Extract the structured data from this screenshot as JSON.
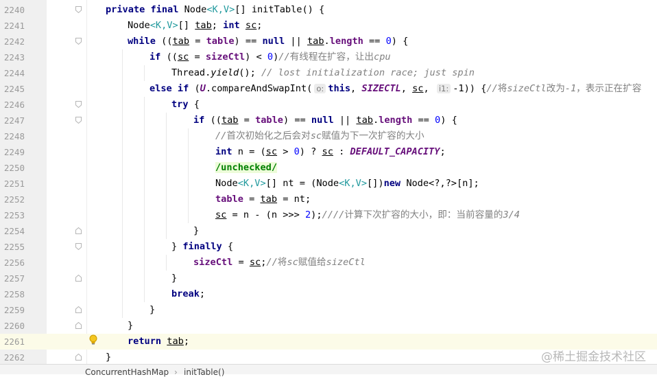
{
  "editor": {
    "lines": [
      {
        "num": "2240",
        "indent": 0,
        "fold": "open",
        "tokens": [
          [
            "kw",
            "private "
          ],
          [
            "kw",
            "final "
          ],
          [
            "",
            "Node"
          ],
          [
            "gen",
            "<K,V>"
          ],
          [
            "",
            "[] initTable() {"
          ]
        ]
      },
      {
        "num": "2241",
        "indent": 1,
        "tokens": [
          [
            "",
            "Node"
          ],
          [
            "gen",
            "<K,V>"
          ],
          [
            "",
            "[] "
          ],
          [
            "ul",
            "tab"
          ],
          [
            "",
            "; "
          ],
          [
            "kw",
            "int "
          ],
          [
            "ul",
            "sc"
          ],
          [
            "",
            ";"
          ]
        ]
      },
      {
        "num": "2242",
        "indent": 1,
        "fold": "open",
        "tokens": [
          [
            "kw",
            "while "
          ],
          [
            "",
            "(("
          ],
          [
            "ul",
            "tab"
          ],
          [
            "",
            " = "
          ],
          [
            "field",
            "table"
          ],
          [
            "",
            ") == "
          ],
          [
            "kw",
            "null"
          ],
          [
            "",
            " || "
          ],
          [
            "ul",
            "tab"
          ],
          [
            "",
            "."
          ],
          [
            "field",
            "length"
          ],
          [
            "",
            " == "
          ],
          [
            "num",
            "0"
          ],
          [
            "",
            ") {"
          ]
        ]
      },
      {
        "num": "2243",
        "indent": 2,
        "tokens": [
          [
            "kw",
            "if "
          ],
          [
            "",
            "(("
          ],
          [
            "ul",
            "sc"
          ],
          [
            "",
            " = "
          ],
          [
            "field",
            "sizeCtl"
          ],
          [
            "",
            ") < "
          ],
          [
            "num",
            "0"
          ],
          [
            "",
            ")"
          ],
          [
            "cmt",
            "//"
          ],
          [
            "cmtcn",
            "有线程在扩容，让出"
          ],
          [
            "cmt",
            "cpu"
          ]
        ]
      },
      {
        "num": "2244",
        "indent": 3,
        "tokens": [
          [
            "",
            "Thread."
          ],
          [
            "static",
            "yield"
          ],
          [
            "",
            "(); "
          ],
          [
            "cmt",
            "// lost initialization race; just spin"
          ]
        ]
      },
      {
        "num": "2245",
        "indent": 2,
        "tokens": [
          [
            "kw",
            "else if "
          ],
          [
            "",
            "("
          ],
          [
            "const",
            "U"
          ],
          [
            "",
            "."
          ],
          [
            "",
            "compareAndSwapInt("
          ],
          [
            "hint",
            "o:"
          ],
          [
            "kw",
            "this"
          ],
          [
            "",
            ", "
          ],
          [
            "const",
            "SIZECTL"
          ],
          [
            "",
            ", "
          ],
          [
            "ul",
            "sc"
          ],
          [
            "",
            ", "
          ],
          [
            "hint",
            "i1:"
          ],
          [
            "",
            "-1)) {"
          ],
          [
            "cmt",
            "//"
          ],
          [
            "cmtcn",
            "将"
          ],
          [
            "cmt",
            "sizeCtl"
          ],
          [
            "cmtcn",
            "改为"
          ],
          [
            "cmt",
            "-1"
          ],
          [
            "cmtcn",
            "，表示正在扩容"
          ]
        ]
      },
      {
        "num": "2246",
        "indent": 3,
        "fold": "open",
        "tokens": [
          [
            "kw",
            "try "
          ],
          [
            "",
            "{"
          ]
        ]
      },
      {
        "num": "2247",
        "indent": 4,
        "fold": "open",
        "tokens": [
          [
            "kw",
            "if "
          ],
          [
            "",
            "(("
          ],
          [
            "ul",
            "tab"
          ],
          [
            "",
            " = "
          ],
          [
            "field",
            "table"
          ],
          [
            "",
            ") == "
          ],
          [
            "kw",
            "null"
          ],
          [
            "",
            " || "
          ],
          [
            "ul",
            "tab"
          ],
          [
            "",
            "."
          ],
          [
            "field",
            "length"
          ],
          [
            "",
            " == "
          ],
          [
            "num",
            "0"
          ],
          [
            "",
            ") {"
          ]
        ]
      },
      {
        "num": "2248",
        "indent": 5,
        "tokens": [
          [
            "cmt",
            "//"
          ],
          [
            "cmtcn",
            "首次初始化之后会对"
          ],
          [
            "cmt",
            "sc"
          ],
          [
            "cmtcn",
            "赋值为下一次扩容的大小"
          ]
        ]
      },
      {
        "num": "2249",
        "indent": 5,
        "tokens": [
          [
            "kw",
            "int "
          ],
          [
            "",
            "n = ("
          ],
          [
            "ul",
            "sc"
          ],
          [
            "",
            " > "
          ],
          [
            "num",
            "0"
          ],
          [
            "",
            ") ? "
          ],
          [
            "ul",
            "sc"
          ],
          [
            "",
            " : "
          ],
          [
            "const",
            "DEFAULT_CAPACITY"
          ],
          [
            "",
            ";"
          ]
        ]
      },
      {
        "num": "2250",
        "indent": 5,
        "tokens": [
          [
            "suppress",
            "/unchecked/"
          ]
        ]
      },
      {
        "num": "2251",
        "indent": 5,
        "tokens": [
          [
            "",
            "Node"
          ],
          [
            "gen",
            "<K,V>"
          ],
          [
            "",
            "[] nt = (Node"
          ],
          [
            "gen",
            "<K,V>"
          ],
          [
            "",
            "[])"
          ],
          [
            "kw",
            "new "
          ],
          [
            "",
            "Node<?,?>[n];"
          ]
        ]
      },
      {
        "num": "2252",
        "indent": 5,
        "tokens": [
          [
            "field",
            "table"
          ],
          [
            "",
            " = "
          ],
          [
            "ul",
            "tab"
          ],
          [
            "",
            " = nt;"
          ]
        ]
      },
      {
        "num": "2253",
        "indent": 5,
        "tokens": [
          [
            "ul",
            "sc"
          ],
          [
            "",
            " = n - (n >>> "
          ],
          [
            "num",
            "2"
          ],
          [
            "",
            ");"
          ],
          [
            "cmt",
            "////"
          ],
          [
            "cmtcn",
            "计算下次扩容的大小，即：当前容量的"
          ],
          [
            "cmt",
            "3/4"
          ]
        ]
      },
      {
        "num": "2254",
        "indent": 4,
        "fold": "close",
        "tokens": [
          [
            "",
            "}"
          ]
        ]
      },
      {
        "num": "2255",
        "indent": 3,
        "fold": "open",
        "tokens": [
          [
            "",
            "} "
          ],
          [
            "kw",
            "finally "
          ],
          [
            "",
            "{"
          ]
        ]
      },
      {
        "num": "2256",
        "indent": 4,
        "tokens": [
          [
            "field",
            "sizeCtl"
          ],
          [
            "",
            " = "
          ],
          [
            "ul",
            "sc"
          ],
          [
            "",
            ";"
          ],
          [
            "cmt",
            "//"
          ],
          [
            "cmtcn",
            "将"
          ],
          [
            "cmt",
            "sc"
          ],
          [
            "cmtcn",
            "赋值给"
          ],
          [
            "cmt",
            "sizeCtl"
          ]
        ]
      },
      {
        "num": "2257",
        "indent": 3,
        "fold": "close",
        "tokens": [
          [
            "",
            "}"
          ]
        ]
      },
      {
        "num": "2258",
        "indent": 3,
        "tokens": [
          [
            "kw",
            "break"
          ],
          [
            "",
            ";"
          ]
        ]
      },
      {
        "num": "2259",
        "indent": 2,
        "fold": "close",
        "tokens": [
          [
            "",
            "}"
          ]
        ]
      },
      {
        "num": "2260",
        "indent": 1,
        "fold": "close",
        "tokens": [
          [
            "",
            "}"
          ]
        ]
      },
      {
        "num": "2261",
        "indent": 1,
        "current": true,
        "bulb": true,
        "tokens": [
          [
            "kw",
            "return "
          ],
          [
            "ul",
            "tab"
          ],
          [
            "",
            ";"
          ]
        ]
      },
      {
        "num": "2262",
        "indent": 0,
        "fold": "close",
        "tokens": [
          [
            "",
            "}"
          ]
        ]
      }
    ]
  },
  "breadcrumb": {
    "class_name": "ConcurrentHashMap",
    "separator": "›",
    "method_name": "initTable()"
  },
  "watermark": "@稀土掘金技术社区",
  "colors": {
    "keyword": "#000080",
    "field": "#660e7a",
    "comment": "#808080",
    "number": "#0000ff",
    "generic": "#20999d",
    "current_line": "#fcfbe8"
  }
}
